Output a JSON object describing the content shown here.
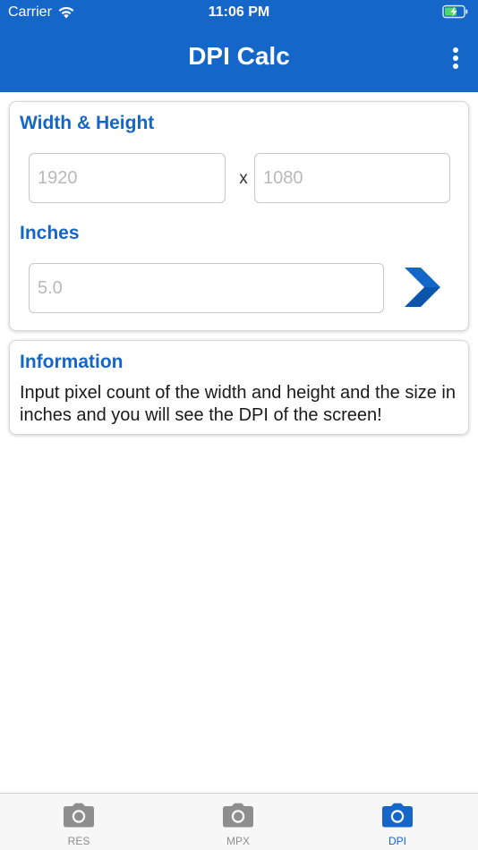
{
  "status_bar": {
    "carrier": "Carrier",
    "time": "11:06 PM",
    "icons": [
      "wifi-icon",
      "battery-charging-icon"
    ]
  },
  "header": {
    "title": "DPI Calc",
    "menu_icon": "more-vertical-icon",
    "background_color": "#1466c8"
  },
  "dimensions_card": {
    "label": "Width & Height",
    "width_input": {
      "value": "",
      "placeholder": "1920"
    },
    "separator": "x",
    "height_input": {
      "value": "",
      "placeholder": "1080"
    },
    "inches_label": "Inches",
    "inches_input": {
      "value": "",
      "placeholder": "5.0"
    },
    "go_icon": "chevron-right-icon"
  },
  "info_card": {
    "title": "Information",
    "text": "Input pixel count of the width and height and the size in inches and you will see the DPI of the screen!"
  },
  "tabbar": {
    "tabs": [
      {
        "label": "RES",
        "icon": "camera-icon",
        "active": false
      },
      {
        "label": "MPX",
        "icon": "camera-icon",
        "active": false
      },
      {
        "label": "DPI",
        "icon": "camera-icon",
        "active": true
      }
    ],
    "active_color": "#1466c8",
    "inactive_color": "#8e8e8e"
  }
}
